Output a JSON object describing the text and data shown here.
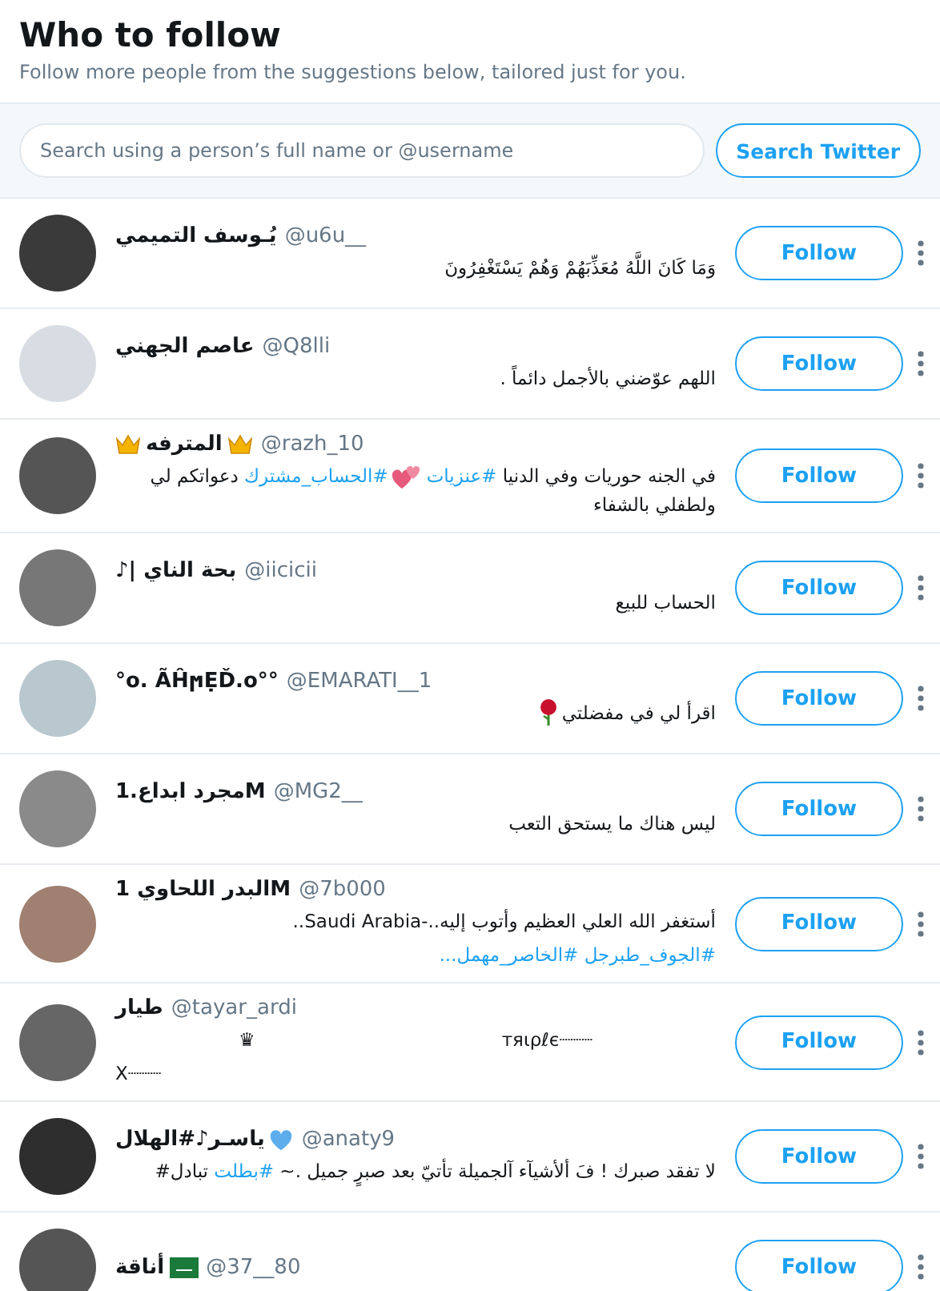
{
  "header": {
    "title": "Who to follow",
    "subtitle": "Follow more people from the suggestions below, tailored just for you."
  },
  "search": {
    "placeholder": "Search using a person’s full name or @username",
    "button": "Search Twitter"
  },
  "users": [
    {
      "name": [
        {
          "kind": "text",
          "text": "يُـوسف التميمي"
        }
      ],
      "handle": "@u6u__",
      "bio": [
        {
          "kind": "rtl",
          "parts": [
            {
              "text": "وَمَا كَانَ اللَّهُ مُعَذِّبَهُمْ وَهُمْ يَسْتَغْفِرُونَ"
            }
          ]
        }
      ],
      "follow": "Follow"
    },
    {
      "name": [
        {
          "kind": "text",
          "text": "عاصم الجهني"
        }
      ],
      "handle": "@Q8lli",
      "bio": [
        {
          "kind": "rtl",
          "parts": [
            {
              "text": "اللهم عوّضني بالأجمل دائماً ."
            }
          ]
        }
      ],
      "follow": "Follow"
    },
    {
      "name": [
        {
          "kind": "crown"
        },
        {
          "kind": "text",
          "text": "المترفه"
        },
        {
          "kind": "crown"
        }
      ],
      "handle": "@razh_10",
      "bio": [
        {
          "kind": "rtl",
          "parts": [
            {
              "text": "في الجنه حوريات وفي الدنيا "
            },
            {
              "text": "#عنزيات",
              "link": true
            },
            {
              "kind": "hearts"
            },
            {
              "text": "#الحساب_مشترك",
              "link": true
            },
            {
              "text": " دعواتكم لي ولطفلي بالشفاء"
            }
          ]
        }
      ],
      "follow": "Follow"
    },
    {
      "name": [
        {
          "kind": "text",
          "text": "بحة الناي |♪"
        }
      ],
      "handle": "@iicicii",
      "bio": [
        {
          "kind": "rtl",
          "parts": [
            {
              "text": "الحساب للبيع"
            }
          ]
        }
      ],
      "follow": "Follow"
    },
    {
      "name": [
        {
          "kind": "text",
          "text": "°°o. ÃĤϻẸĎ.o°"
        }
      ],
      "handle": "@EMARATI__1",
      "bio": [
        {
          "kind": "rtl",
          "parts": [
            {
              "text": "اقرأ لي في مفضلتي"
            },
            {
              "kind": "rose"
            }
          ]
        }
      ],
      "follow": "Follow"
    },
    {
      "name": [
        {
          "kind": "text",
          "text": "Mمجرد ابداع.1"
        }
      ],
      "handle": "@MG2__",
      "bio": [
        {
          "kind": "rtl",
          "parts": [
            {
              "text": "ليس هناك ما يستحق التعب"
            }
          ]
        }
      ],
      "follow": "Follow"
    },
    {
      "name": [
        {
          "kind": "text",
          "text": "Mالبدر اللحاوي 1"
        }
      ],
      "handle": "@7b000",
      "bio": [
        {
          "kind": "rtl",
          "parts": [
            {
              "text": "أستغفر الله العلي العظيم وأتوب إليه..-Saudi Arabia.."
            }
          ]
        },
        {
          "kind": "rtl",
          "parts": [
            {
              "text": "#الجوف_طبرجل #الخاصر_مهمل...",
              "link": true
            }
          ]
        }
      ],
      "follow": "Follow"
    },
    {
      "name": [
        {
          "kind": "text",
          "text": "طيار"
        }
      ],
      "handle": "@tayar_ardi",
      "bio": [
        {
          "kind": "split",
          "parts": [
            {
              "text": "┈┈┈тяιρℓє"
            },
            {
              "text": "♛"
            }
          ]
        },
        {
          "kind": "ltr",
          "parts": [
            {
              "text": "X┈┈┈"
            }
          ]
        }
      ],
      "follow": "Follow"
    },
    {
      "name": [
        {
          "kind": "text",
          "text": "ياسـر♪#الهلال"
        },
        {
          "kind": "heart"
        }
      ],
      "handle": "@anaty9",
      "bio": [
        {
          "kind": "rtl",
          "parts": [
            {
              "text": "لا تفقد صبرك ! فَ ألأشيآء آلجميلة تأتيّ بعد صبرٍ جميل .~ "
            },
            {
              "text": "#بطلت",
              "link": true
            },
            {
              "text": " تبادل#"
            }
          ]
        }
      ],
      "follow": "Follow"
    },
    {
      "name": [
        {
          "kind": "text",
          "text": "أناقة"
        },
        {
          "kind": "flag"
        }
      ],
      "handle": "@37__80",
      "follow": "Follow"
    }
  ]
}
